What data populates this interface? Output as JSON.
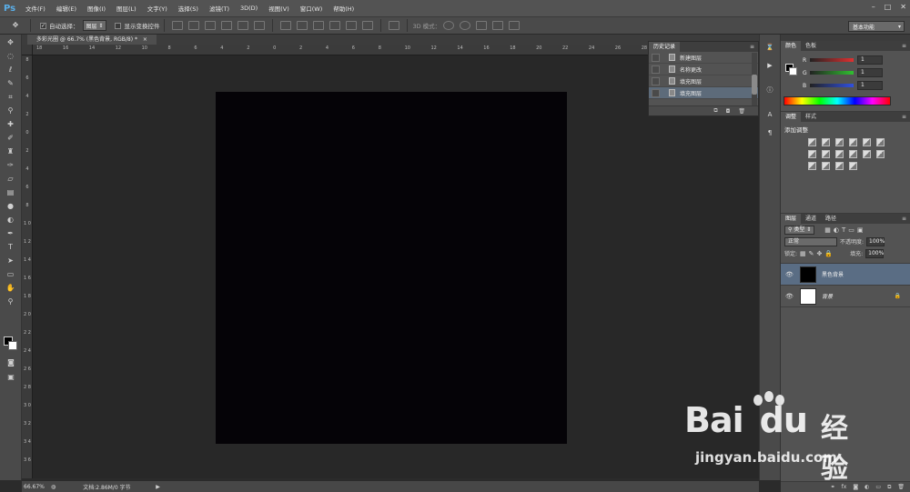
{
  "app": {
    "logo": "Ps"
  },
  "menu": [
    "文件(F)",
    "编辑(E)",
    "图像(I)",
    "图层(L)",
    "文字(Y)",
    "选择(S)",
    "滤镜(T)",
    "3D(D)",
    "视图(V)",
    "窗口(W)",
    "帮助(H)"
  ],
  "window_controls": {
    "minimize": "–",
    "maximize": "□",
    "close": "✕"
  },
  "options": {
    "auto_select_label": "自动选择：",
    "auto_select_value": "图层",
    "show_transform_label": "显示变换控件",
    "mode_3d_label": "3D 模式：",
    "workspace": "基本功能"
  },
  "document": {
    "tab_title": "多彩光圈 @ 66.7% (黑色背景, RGB/8) *",
    "canvas_color": "#050307"
  },
  "ruler": {
    "h_labels": [
      "18",
      "16",
      "14",
      "12",
      "10",
      "8",
      "6",
      "4",
      "2",
      "0",
      "2",
      "4",
      "6",
      "8",
      "10",
      "12",
      "14",
      "16",
      "18",
      "20",
      "22",
      "24",
      "26",
      "28",
      "30",
      "32",
      "34"
    ],
    "v_labels": [
      "8",
      "6",
      "4",
      "2",
      "0",
      "2",
      "4",
      "6",
      "8",
      "1 0",
      "1 2",
      "1 4",
      "1 6",
      "1 8",
      "2 0",
      "2 2",
      "2 4",
      "2 6",
      "2 8",
      "3 0",
      "3 2",
      "3 4",
      "3 6"
    ]
  },
  "status": {
    "zoom": "66.67%",
    "doc_info": "文档:2.86M/0 字节"
  },
  "history": {
    "tab": "历史记录",
    "items": [
      "新建图层",
      "名称更改",
      "填充图层",
      "填充图层"
    ],
    "selected_index": 3
  },
  "color_panel": {
    "tabs": [
      "颜色",
      "色板"
    ],
    "channels": [
      {
        "name": "R",
        "value": "1",
        "color": "#e04040"
      },
      {
        "name": "G",
        "value": "1",
        "color": "#40c040"
      },
      {
        "name": "B",
        "value": "1",
        "color": "#4060e0"
      }
    ]
  },
  "adjust_panel": {
    "tabs": [
      "调整",
      "样式"
    ],
    "title": "添加调整"
  },
  "layers_panel": {
    "tabs": [
      "图层",
      "通道",
      "路径"
    ],
    "filter": "类型",
    "blend_mode": "正常",
    "opacity_label": "不透明度:",
    "opacity": "100%",
    "lock_label": "锁定:",
    "fill_label": "填充:",
    "fill": "100%",
    "layers": [
      {
        "name": "黑色背景",
        "thumb": "#000000",
        "selected": true,
        "locked": false
      },
      {
        "name": "背景",
        "thumb": "#ffffff",
        "selected": false,
        "locked": true
      }
    ]
  },
  "watermark": {
    "logo_a": "Bai",
    "logo_b": "du",
    "logo_cn": "经验",
    "url": "jingyan.baidu.com"
  }
}
